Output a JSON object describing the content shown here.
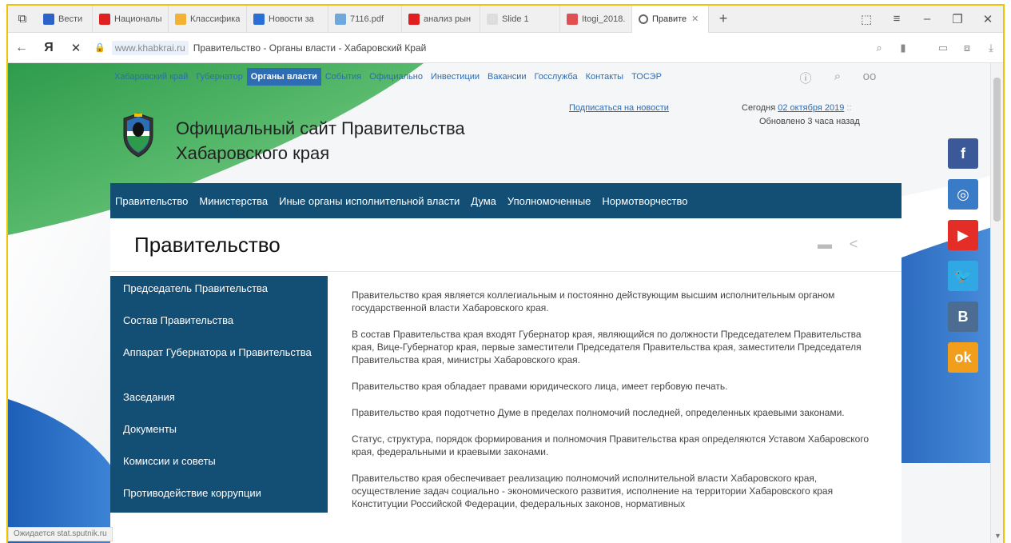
{
  "browser": {
    "tabs": [
      {
        "label": "Вести",
        "fav_color": "#2b63c9",
        "active": false
      },
      {
        "label": "Национальн",
        "fav_color": "#e02020",
        "active": false
      },
      {
        "label": "Классифика",
        "fav_color": "#f2b233",
        "active": false
      },
      {
        "label": "Новости за",
        "fav_color": "#2a6fd6",
        "active": false
      },
      {
        "label": "7116.pdf",
        "fav_color": "#6fa8dc",
        "active": false
      },
      {
        "label": "анализ рын",
        "fav_color": "#e02020",
        "active": false
      },
      {
        "label": "Slide 1",
        "fav_color": "#dddddd",
        "active": false
      },
      {
        "label": "Itogi_2018.",
        "fav_color": "#e05050",
        "active": false
      },
      {
        "label": "Правите",
        "fav_color": "#ffffff",
        "active": true
      }
    ],
    "address": {
      "domain": "www.khabkrai.ru",
      "title": "Правительство - Органы власти - Хабаровский Край"
    },
    "status": "Ожидается stat.sputnik.ru"
  },
  "site": {
    "topnav": [
      "Хабаровский край",
      "Губернатор",
      "Органы власти",
      "События",
      "Официально",
      "Инвестиции",
      "Вакансии",
      "Госслужба",
      "Контакты",
      "ТОСЭР"
    ],
    "topnav_active": 2,
    "title_line1": "Официальный сайт Правительства",
    "title_line2": "Хабаровского края",
    "subscribe": "Подписаться на новости",
    "today_label": "Сегодня",
    "today_date": "02 октября 2019",
    "updated": "Обновлено 3 часа назад",
    "mainmenu": [
      "Правительство",
      "Министерства",
      "Иные органы исполнительной власти",
      "Дума",
      "Уполномоченные",
      "Нормотворчество"
    ],
    "page_title": "Правительство",
    "sidemenu": [
      "Председатель Правительства",
      "Состав Правительства",
      "Аппарат Губернатора и Правительства",
      "Заседания",
      "Документы",
      "Комиссии и советы",
      "Противодействие коррупции"
    ],
    "paragraphs": [
      "Правительство края является коллегиальным и постоянно действующим высшим исполнительным органом государственной власти Хабаровского края.",
      "В состав Правительства края входят Губернатор края, являющийся по должности Председателем Правительства края, Вице-Губернатор края, первые заместители Председателя Правительства края, заместители Председателя Правительства края, министры Хабаровского края.",
      "Правительство края обладает правами юридического лица, имеет гербовую печать.",
      "Правительство края подотчетно Думе в пределах полномочий последней, определенных краевыми законами.",
      "Статус, структура, порядок формирования и полномочия Правительства края определяются Уставом Хабаровского края, федеральными и краевыми законами.",
      "Правительство края обеспечивает реализацию полномочий исполнительной власти Хабаровского края, осуществление задач социально - экономического развития, исполнение на территории Хабаровского края Конституции Российской Федерации, федеральных законов, нормативных"
    ],
    "social": [
      {
        "label": "f",
        "color": "#3b5998"
      },
      {
        "label": "◎",
        "color": "#3a7bc8"
      },
      {
        "label": "▶",
        "color": "#e52d27"
      },
      {
        "label": "🐦",
        "color": "#2fa8e4"
      },
      {
        "label": "В",
        "color": "#4c6c91"
      },
      {
        "label": "ok",
        "color": "#f29e1d"
      }
    ]
  },
  "colors": {
    "accent": "#2d6db4",
    "menu_bg": "#134e75",
    "frame": "#f1c200"
  }
}
